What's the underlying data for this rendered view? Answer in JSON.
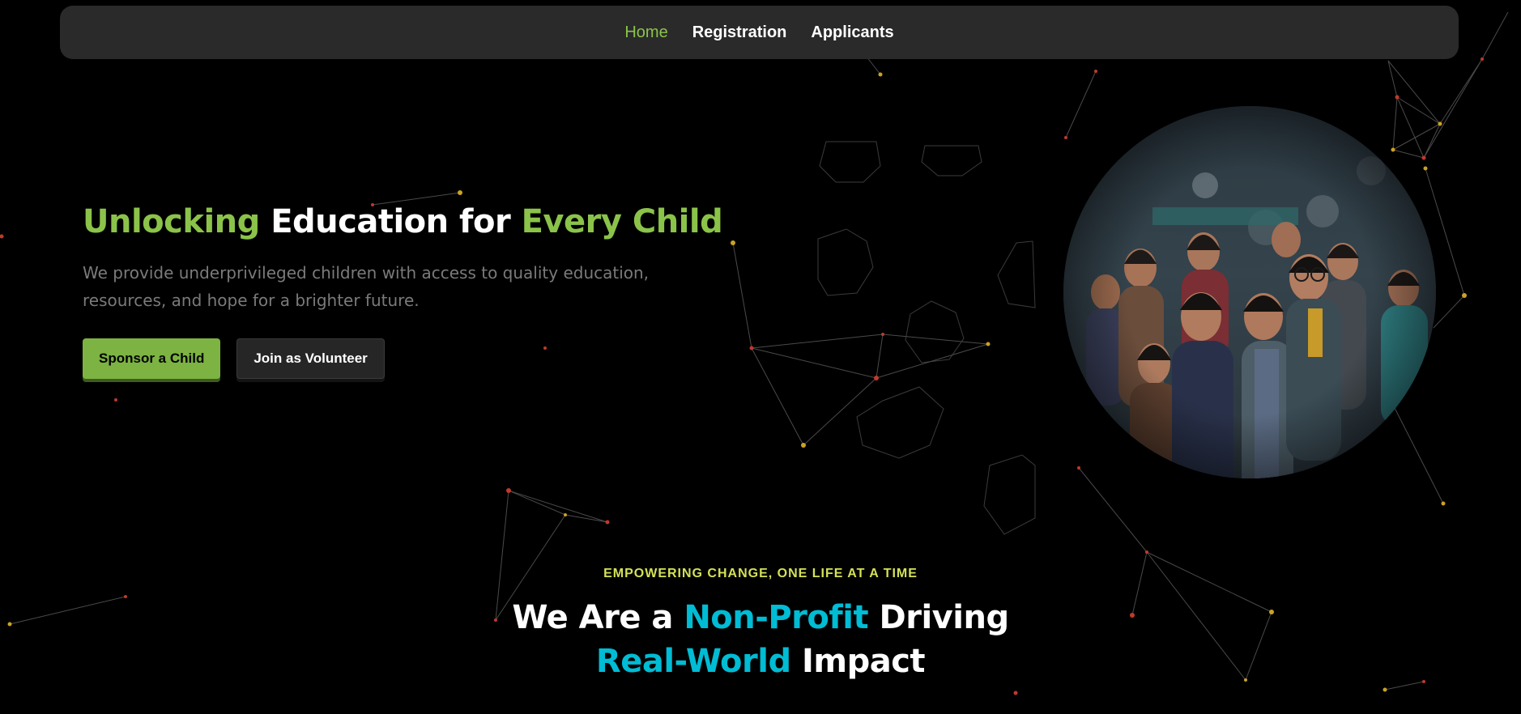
{
  "colors": {
    "accent_green": "#8bc34a",
    "accent_cyan": "#00bcd4",
    "eyebrow_yellow": "#d4e157",
    "nav_bg": "#2a2a2a",
    "background": "#000000"
  },
  "nav": {
    "items": [
      {
        "label": "Home",
        "active": true
      },
      {
        "label": "Registration",
        "active": false
      },
      {
        "label": "Applicants",
        "active": false
      }
    ]
  },
  "hero": {
    "title": {
      "part1": "Unlocking",
      "part2": " Education for ",
      "part3": "Every Child"
    },
    "description": "We provide underprivileged children with access to quality education, resources, and hope for a brighter future.",
    "primary_button": "Sponsor a Child",
    "secondary_button": "Join as Volunteer",
    "image": "group-of-smiling-children-photo"
  },
  "section": {
    "eyebrow": "EMPOWERING CHANGE, ONE LIFE AT A TIME",
    "title": {
      "part1": "We Are a ",
      "part2": "Non-Profit",
      "part3": " Driving",
      "part4": "Real-World",
      "part5": " Impact"
    }
  }
}
